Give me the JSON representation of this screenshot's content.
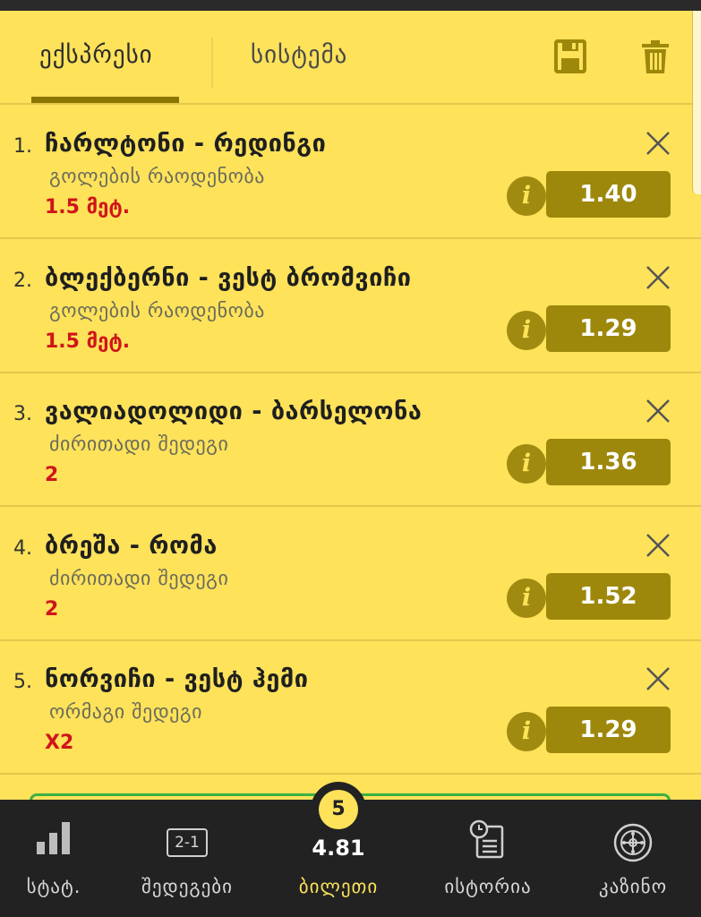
{
  "tabs": {
    "express": "ექსპრესი",
    "system": "სისტემა",
    "save_icon": "save-icon",
    "trash_icon": "trash-icon"
  },
  "bets": [
    {
      "num": "1.",
      "match": "ჩარლტონი - რედინგი",
      "market": "გოლების რაოდენობა",
      "pick": "1.5 მეტ.",
      "odds": "1.40"
    },
    {
      "num": "2.",
      "match": "ბლექბერნი - ვესტ ბრომვიჩი",
      "market": "გოლების რაოდენობა",
      "pick": "1.5 მეტ.",
      "odds": "1.29"
    },
    {
      "num": "3.",
      "match": "ვალიადოლიდი - ბარსელონა",
      "market": "ძირითადი შედეგი",
      "pick": "2",
      "odds": "1.36"
    },
    {
      "num": "4.",
      "match": "ბრეშა - რომა",
      "market": "ძირითადი შედეგი",
      "pick": "2",
      "odds": "1.52"
    },
    {
      "num": "5.",
      "match": "ნორვიჩი - ვესტ ჰემი",
      "market": "ორმაგი შედეგი",
      "pick": "X2",
      "odds": "1.29"
    }
  ],
  "info_glyph": "i",
  "nav": {
    "stats": "სტატ.",
    "results": "შედეგები",
    "results_icon_text": "2-1",
    "ticket": "ბილეთი",
    "ticket_count": "5",
    "ticket_total": "4.81",
    "history": "ისტორია",
    "casino": "კაზინო"
  },
  "colors": {
    "background": "#fde25a",
    "odds_button": "#9e880c",
    "pick_red": "#d0141a",
    "nav_bg": "#222222",
    "nav_active": "#fde25a"
  }
}
